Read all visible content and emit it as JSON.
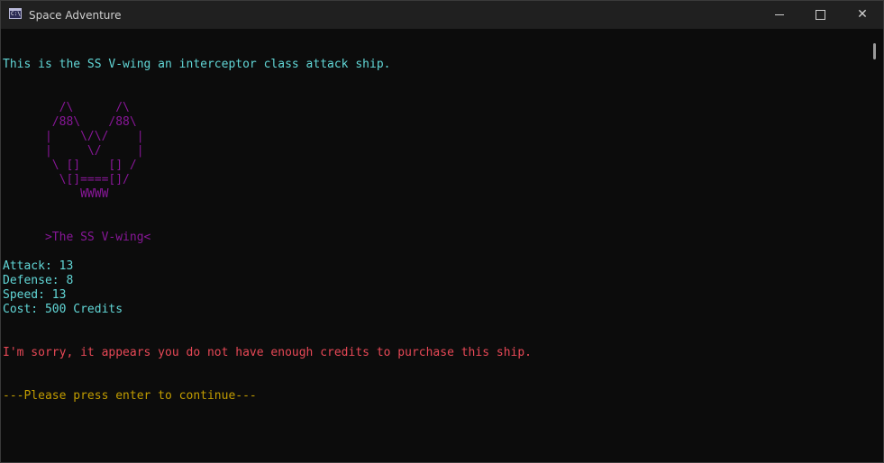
{
  "window": {
    "title": "Space Adventure",
    "icon": "console-app-icon",
    "buttons": {
      "minimize": "minimize-icon",
      "maximize": "maximize-icon",
      "close": "close-icon"
    }
  },
  "console": {
    "intro": "This is the SS V-wing an interceptor class attack ship.",
    "ship_art": [
      "        /\\      /\\",
      "       /88\\    /88\\",
      "      |    \\/\\/    |",
      "      |     \\/     |",
      "       \\ []    [] /",
      "        \\[]====[]/",
      "           WWWW"
    ],
    "ship_name": "      >The SS V-wing<",
    "stats": {
      "attack": "Attack: 13",
      "defense": "Defense: 8",
      "speed": "Speed: 13",
      "cost": "Cost: 500 Credits"
    },
    "error_message": "I'm sorry, it appears you do not have enough credits to purchase this ship.",
    "continue_prompt": "---Please press enter to continue---",
    "colors": {
      "background": "#0c0c0c",
      "cyan": "#61d6d6",
      "purple": "#881798",
      "red": "#e74856",
      "yellow": "#c19c00"
    }
  }
}
